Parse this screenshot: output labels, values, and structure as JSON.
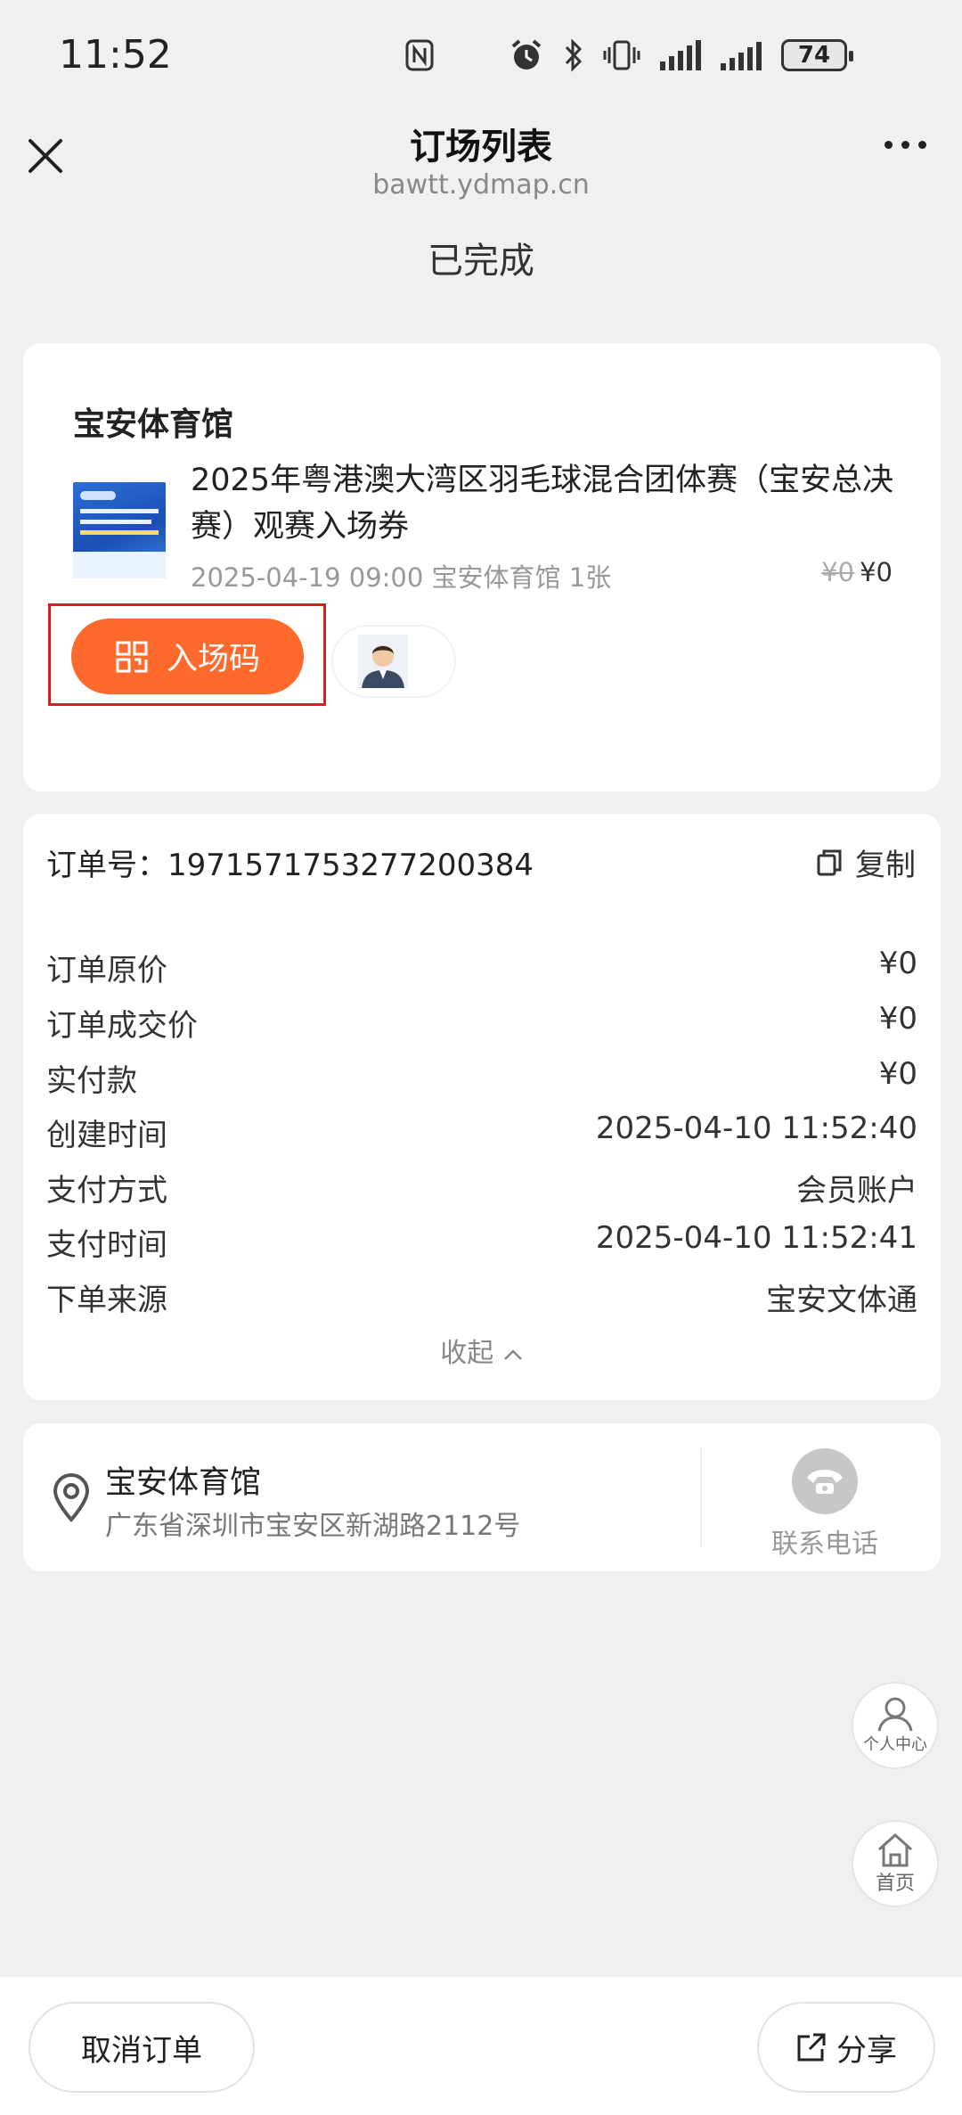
{
  "status_bar": {
    "time": "11:52",
    "battery": "74"
  },
  "nav": {
    "title": "订场列表",
    "domain": "bawtt.ydmap.cn"
  },
  "order_status": "已完成",
  "booking": {
    "venue": "宝安体育馆",
    "event_title": "2025年粤港澳大湾区羽毛球混合团体赛（宝安总决赛）观赛入场券",
    "meta": "2025-04-19 09:00 宝安体育馆 1张",
    "original_price": "¥0",
    "price": "¥0",
    "entry_code_label": "入场码"
  },
  "order": {
    "number_label": "订单号：",
    "number": "1971571753277200384",
    "copy_label": "复制",
    "rows": [
      {
        "key": "订单原价",
        "value": "¥0"
      },
      {
        "key": "订单成交价",
        "value": "¥0"
      },
      {
        "key": "实付款",
        "value": "¥0"
      },
      {
        "key": "创建时间",
        "value": "2025-04-10 11:52:40"
      },
      {
        "key": "支付方式",
        "value": "会员账户"
      },
      {
        "key": "支付时间",
        "value": "2025-04-10 11:52:41"
      },
      {
        "key": "下单来源",
        "value": "宝安文体通"
      }
    ],
    "collapse_label": "收起"
  },
  "location": {
    "name": "宝安体育馆",
    "address": "广东省深圳市宝安区新湖路2112号",
    "phone_label": "联系电话"
  },
  "floating": {
    "user_center": "个人中心",
    "home": "首页"
  },
  "bottom": {
    "cancel_label": "取消订单",
    "share_label": "分享"
  },
  "colors": {
    "accent": "#ff6a2c",
    "highlight": "#d81e1e",
    "background": "#f0f0f0"
  }
}
